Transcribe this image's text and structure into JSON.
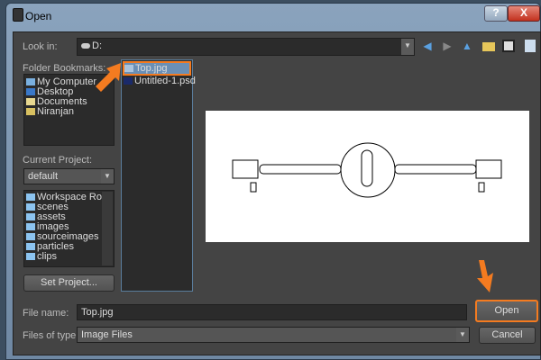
{
  "window": {
    "title": "Open",
    "help": "?",
    "close": "X"
  },
  "look_in": {
    "label": "Look in:",
    "value": "D:"
  },
  "bookmarks": {
    "label": "Folder Bookmarks:",
    "items": [
      "My Computer",
      "Desktop",
      "Documents",
      "Niranjan"
    ]
  },
  "project": {
    "label": "Current Project:",
    "value": "default",
    "folders": [
      "Workspace Root",
      "scenes",
      "assets",
      "images",
      "sourceimages",
      "particles",
      "clips"
    ],
    "set_button": "Set Project..."
  },
  "files": [
    "Top.jpg",
    "Untitled-1.psd"
  ],
  "file_name": {
    "label": "File name:",
    "value": "Top.jpg"
  },
  "file_type": {
    "label": "Files of type:",
    "value": "Image Files"
  },
  "buttons": {
    "open": "Open",
    "cancel": "Cancel"
  },
  "colors": {
    "highlight": "#f47b20",
    "selection": "#6a8fb5"
  }
}
